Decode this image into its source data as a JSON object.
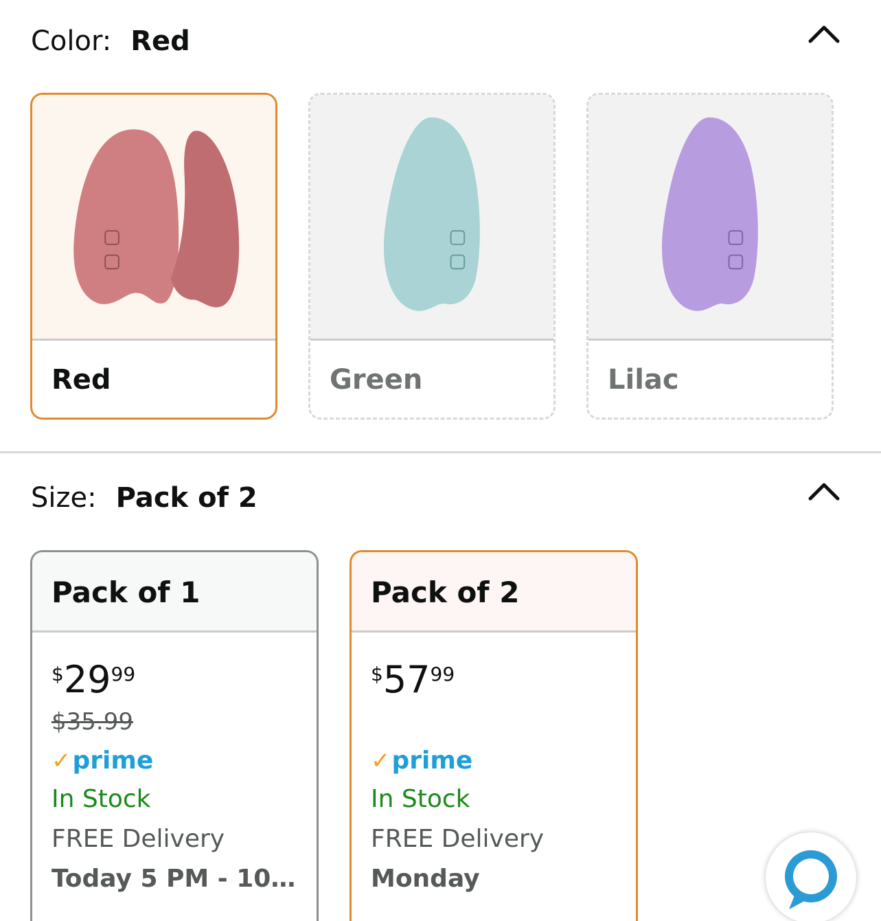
{
  "color_section": {
    "label": "Color:",
    "selected_value": "Red",
    "options": [
      {
        "name": "Red",
        "selected": true,
        "color": "#c9767c"
      },
      {
        "name": "Green",
        "selected": false,
        "color": "#a9d3d4"
      },
      {
        "name": "Lilac",
        "selected": false,
        "color": "#b79ce0"
      }
    ],
    "chevron_icon": "chevron-up-icon"
  },
  "size_section": {
    "label": "Size:",
    "selected_value": "Pack of 2",
    "chevron_icon": "chevron-up-icon",
    "options": [
      {
        "title": "Pack of 1",
        "selected": false,
        "price_symbol": "$",
        "price_whole": "29",
        "price_fraction": "99",
        "list_price": "$35.99",
        "prime": "prime",
        "stock": "In Stock",
        "delivery": "FREE Delivery",
        "delivery_date": "Today 5 PM - 10…"
      },
      {
        "title": "Pack of 2",
        "selected": true,
        "price_symbol": "$",
        "price_whole": "57",
        "price_fraction": "99",
        "list_price": "",
        "prime": "prime",
        "stock": "In Stock",
        "delivery": "FREE Delivery",
        "delivery_date": "Monday"
      }
    ]
  },
  "colors": {
    "accent_selected": "#e08a2e",
    "in_stock": "#1a8a1a",
    "prime_blue": "#1f9fd9",
    "alexa_blue": "#2a9bd4"
  },
  "floating": {
    "icon": "alexa-icon"
  }
}
